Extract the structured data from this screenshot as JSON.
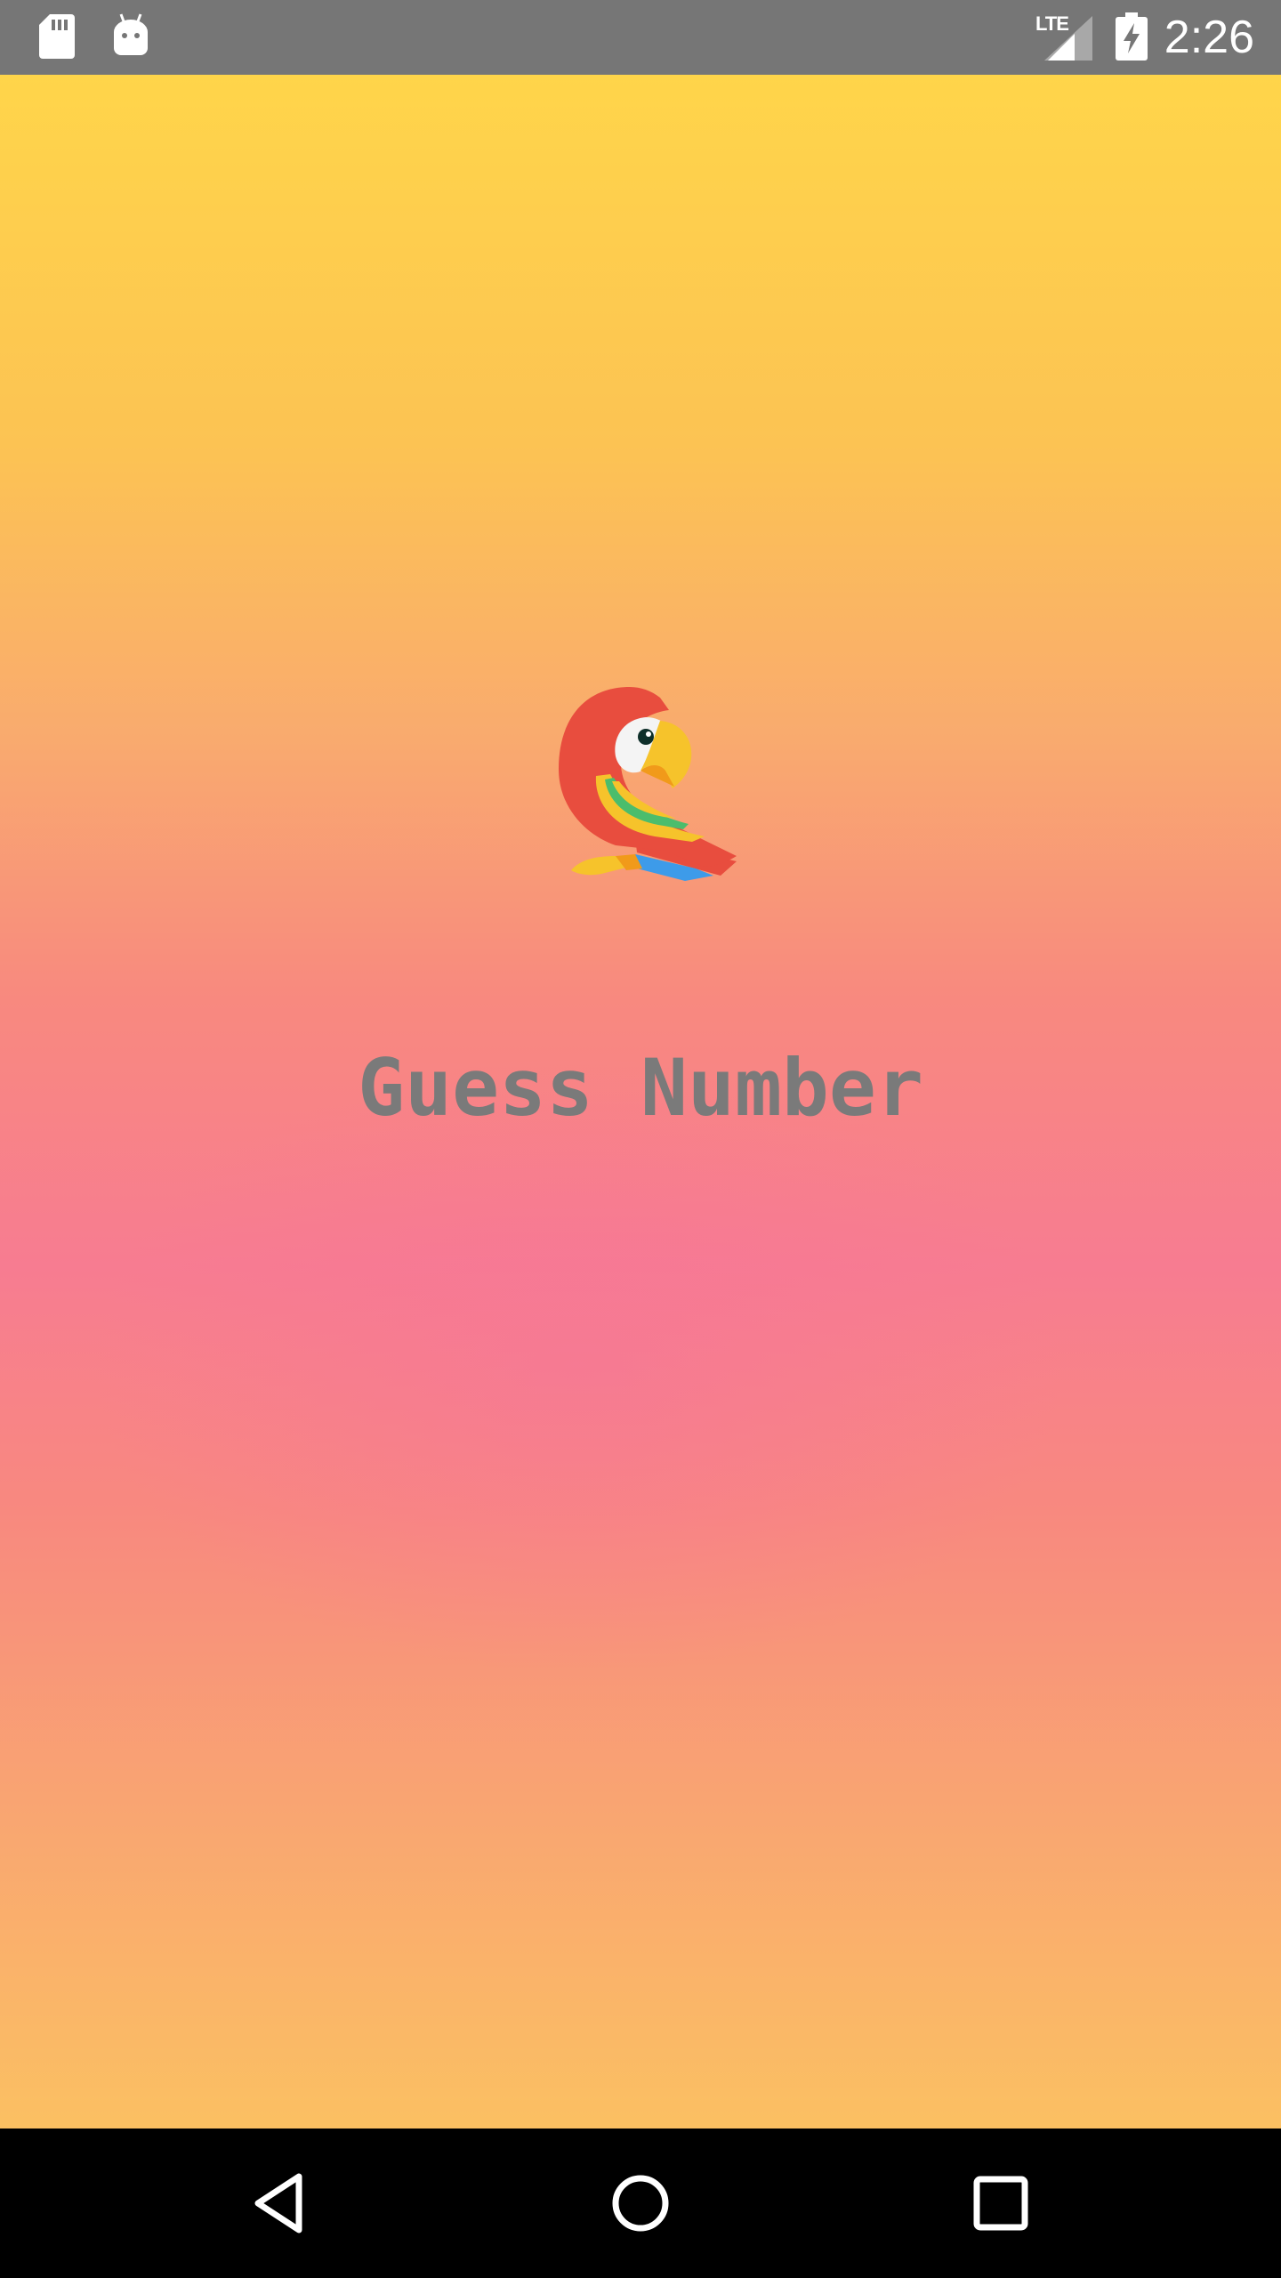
{
  "status_bar": {
    "network_label": "LTE",
    "time": "2:26",
    "icons": [
      "sd-card-icon",
      "android-debug-icon",
      "signal-icon",
      "battery-charging-icon"
    ]
  },
  "app": {
    "title": "Guess Number",
    "logo_icon": "parrot-icon"
  },
  "nav_bar": {
    "icons": [
      "back-icon",
      "home-icon",
      "recents-icon"
    ]
  },
  "colors": {
    "gradient_top": "#ffd54a",
    "gradient_mid": "#f77c91",
    "gradient_bottom": "#fbc062",
    "title_text": "#7a7a7a",
    "status_bar": "#767676",
    "nav_bar": "#000000"
  }
}
